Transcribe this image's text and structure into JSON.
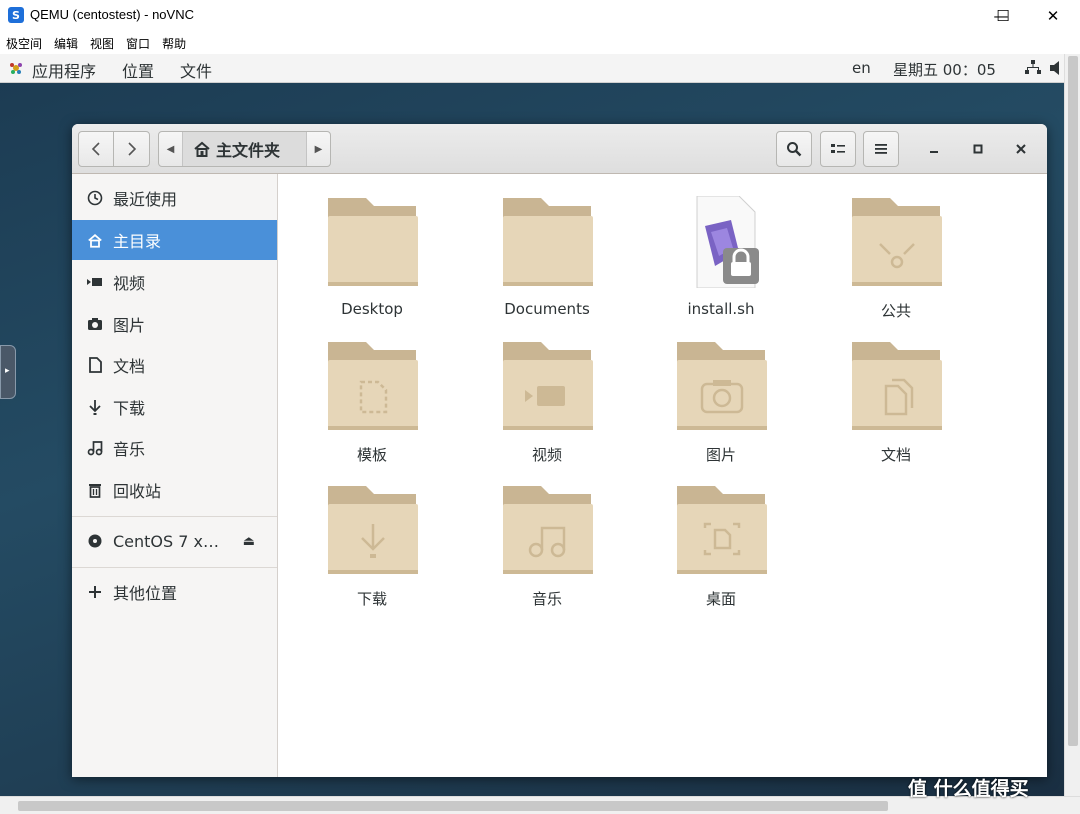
{
  "window": {
    "title": "QEMU (centostest) - noVNC",
    "icon_letter": "S",
    "controls": {
      "minimize": "—",
      "maximize": "☐",
      "close": "✕"
    }
  },
  "menubar": [
    "极空间",
    "编辑",
    "视图",
    "窗口",
    "帮助"
  ],
  "gnome_top": {
    "apps": "应用程序",
    "places": "位置",
    "files": "文件",
    "lang": "en",
    "clock": "星期五 00：05"
  },
  "nautilus": {
    "path_label": "主文件夹",
    "sidebar": [
      {
        "label": "最近使用",
        "icon": "clock-icon"
      },
      {
        "label": "主目录",
        "icon": "home-icon",
        "active": true
      },
      {
        "label": "视频",
        "icon": "video-icon"
      },
      {
        "label": "图片",
        "icon": "camera-icon"
      },
      {
        "label": "文档",
        "icon": "document-icon"
      },
      {
        "label": "下载",
        "icon": "download-icon"
      },
      {
        "label": "音乐",
        "icon": "music-icon"
      },
      {
        "label": "回收站",
        "icon": "trash-icon"
      }
    ],
    "device": {
      "label": "CentOS 7 x…",
      "icon": "disc-icon"
    },
    "other_places": {
      "label": "其他位置",
      "icon": "plus-icon"
    },
    "items": [
      {
        "label": "Desktop",
        "kind": "folder"
      },
      {
        "label": "Documents",
        "kind": "folder"
      },
      {
        "label": "install.sh",
        "kind": "script"
      },
      {
        "label": "公共",
        "kind": "folder-share"
      },
      {
        "label": "模板",
        "kind": "folder-template"
      },
      {
        "label": "视频",
        "kind": "folder-video"
      },
      {
        "label": "图片",
        "kind": "folder-camera"
      },
      {
        "label": "文档",
        "kind": "folder-docs"
      },
      {
        "label": "下载",
        "kind": "folder-download"
      },
      {
        "label": "音乐",
        "kind": "folder-music"
      },
      {
        "label": "桌面",
        "kind": "folder-desktop"
      }
    ]
  },
  "watermark": "值 什么值得买",
  "colors": {
    "selection": "#4a90d9",
    "folder": "#e6d6b8",
    "folder_tab": "#c9b593"
  }
}
